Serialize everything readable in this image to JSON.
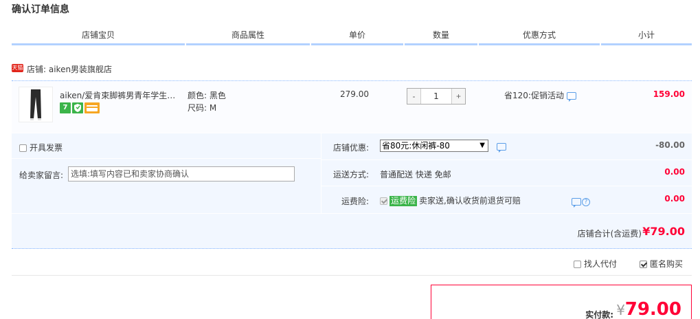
{
  "page_title": "确认订单信息",
  "columns": [
    "店铺宝贝",
    "商品属性",
    "单价",
    "数量",
    "优惠方式",
    "小计"
  ],
  "shop": {
    "badge": "天猫",
    "label": "店铺: aiken男装旗舰店"
  },
  "item": {
    "title": "aiken/爱肯束脚裤男青年学生潮流休闲裤",
    "attr_color": "颜色: 黑色",
    "attr_size": "尺码: M",
    "service_icon_7": "7",
    "unit_price": "279.00",
    "quantity": "1",
    "qty_minus": "-",
    "qty_plus": "+",
    "promo": "省120:促销活动",
    "subtotal": "159.00"
  },
  "options": {
    "invoice_label": "开具发票",
    "message_label": "给卖家留言:",
    "message_placeholder": "选填:填写内容已和卖家协商确认",
    "shop_discount_label": "店铺优惠:",
    "shop_discount_value": "省80元:休闲裤-80",
    "shop_discount_amount": "-80.00",
    "shipping_label": "运送方式:",
    "shipping_value": "普通配送 快递 免邮",
    "shipping_amount": "0.00",
    "insurance_label": "运费险:",
    "insurance_tag": "运费险",
    "insurance_value": "卖家送,确认收货前退货可赔",
    "insurance_amount": "0.00"
  },
  "shop_total": {
    "label": "店铺合计(含运费)",
    "amount": "¥79.00"
  },
  "extras": {
    "proxy_label": "找人代付",
    "anonymous_label": "匿名购买"
  },
  "payment": {
    "label": "实付款:",
    "currency": "¥",
    "amount": "79.00"
  }
}
